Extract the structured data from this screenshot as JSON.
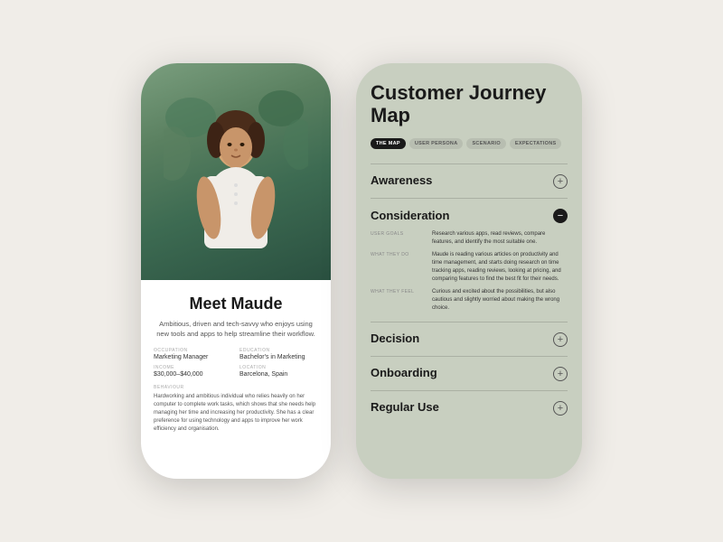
{
  "left_phone": {
    "profile_name": "Meet Maude",
    "profile_bio": "Ambitious, driven and tech-savvy who enjoys using new tools and apps to help streamline their workflow.",
    "details": [
      {
        "label": "OCCUPATION",
        "value": "Marketing Manager"
      },
      {
        "label": "EDUCATION",
        "value": "Bachelor's in Marketing"
      },
      {
        "label": "INCOME",
        "value": "$30,000–$40,000"
      },
      {
        "label": "LOCATION",
        "value": "Barcelona, Spain"
      }
    ],
    "behaviour_label": "BEHAVIOUR",
    "behaviour_text": "Hardworking and ambitious individual who relies heavily on her computer to complete work tasks, which shows that she needs help managing her time and increasing her productivity. She has a clear preference for using technology and apps to improve her work efficiency and organisation."
  },
  "right_phone": {
    "title": "Customer Journey Map",
    "tabs": [
      {
        "label": "THE MAP",
        "active": true
      },
      {
        "label": "USER PERSONA",
        "active": false
      },
      {
        "label": "SCENARIO",
        "active": false
      },
      {
        "label": "EXPECTATIONS",
        "active": false
      }
    ],
    "sections": [
      {
        "title": "Awareness",
        "expanded": false
      },
      {
        "title": "Consideration",
        "expanded": true,
        "rows": [
          {
            "label": "USER GOALS",
            "value": "Research various apps, read reviews, compare features, and identify the most suitable one."
          },
          {
            "label": "WHAT THEY DO",
            "value": "Maude is reading various articles on productivity and time management, and starts doing research on time tracking apps, reading reviews, looking at pricing, and comparing features to find the best fit for their needs."
          },
          {
            "label": "WHAT THEY FEEL",
            "value": "Curious and excited about the possibilities, but also cautious and slightly worried about making the wrong choice."
          }
        ]
      },
      {
        "title": "Decision",
        "expanded": false
      },
      {
        "title": "Onboarding",
        "expanded": false
      },
      {
        "title": "Regular Use",
        "expanded": false
      }
    ],
    "icons": {
      "plus": "+",
      "minus": "−"
    }
  }
}
